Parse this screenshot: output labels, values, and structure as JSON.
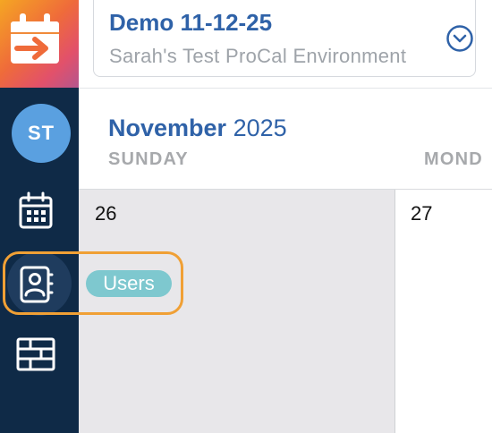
{
  "app": {
    "logo_icon": "calendar-arrow-icon"
  },
  "sidebar": {
    "avatar_initials": "ST",
    "items": [
      {
        "icon": "calendar-icon"
      },
      {
        "icon": "contacts-book-icon",
        "tooltip": "Users",
        "active": true
      },
      {
        "icon": "table-grid-icon"
      }
    ]
  },
  "environment": {
    "title": "Demo 11-12-25",
    "subtitle": "Sarah's Test ProCal Environment",
    "toggle_icon": "chevron-down-circle-icon"
  },
  "calendar": {
    "month_name": "November",
    "year": "2025",
    "weekdays": [
      "SUNDAY",
      "MOND"
    ],
    "dates": [
      "26",
      "27"
    ]
  },
  "colors": {
    "sidebar_bg": "#0f2a47",
    "accent": "#2f62a8",
    "avatar": "#5aa0e0",
    "tooltip": "#7ec8cf",
    "highlight": "#f0a035"
  }
}
